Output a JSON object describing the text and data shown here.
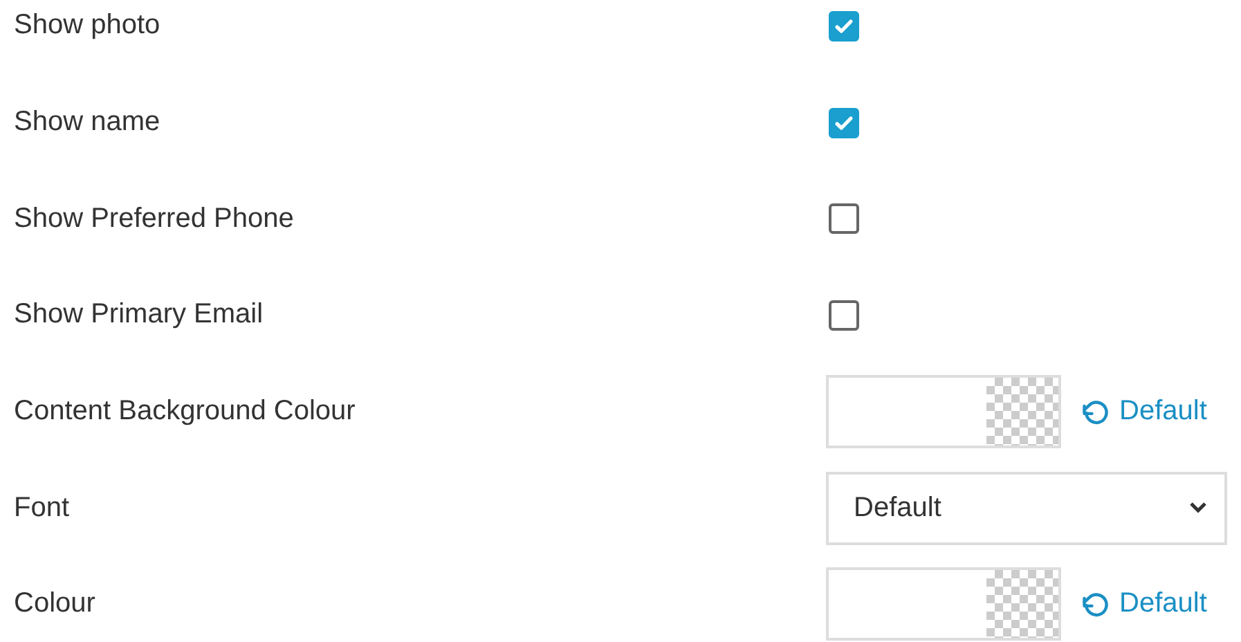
{
  "settings": [
    {
      "kind": "checkbox",
      "label": "Show photo",
      "checked": true
    },
    {
      "kind": "checkbox",
      "label": "Show name",
      "checked": true
    },
    {
      "kind": "checkbox",
      "label": "Show Preferred Phone",
      "checked": false
    },
    {
      "kind": "checkbox",
      "label": "Show Primary Email",
      "checked": false
    },
    {
      "kind": "color",
      "label": "Content Background Colour",
      "reset": "Default"
    },
    {
      "kind": "select",
      "label": "Font",
      "value": "Default"
    },
    {
      "kind": "color",
      "label": "Colour",
      "reset": "Default"
    }
  ]
}
